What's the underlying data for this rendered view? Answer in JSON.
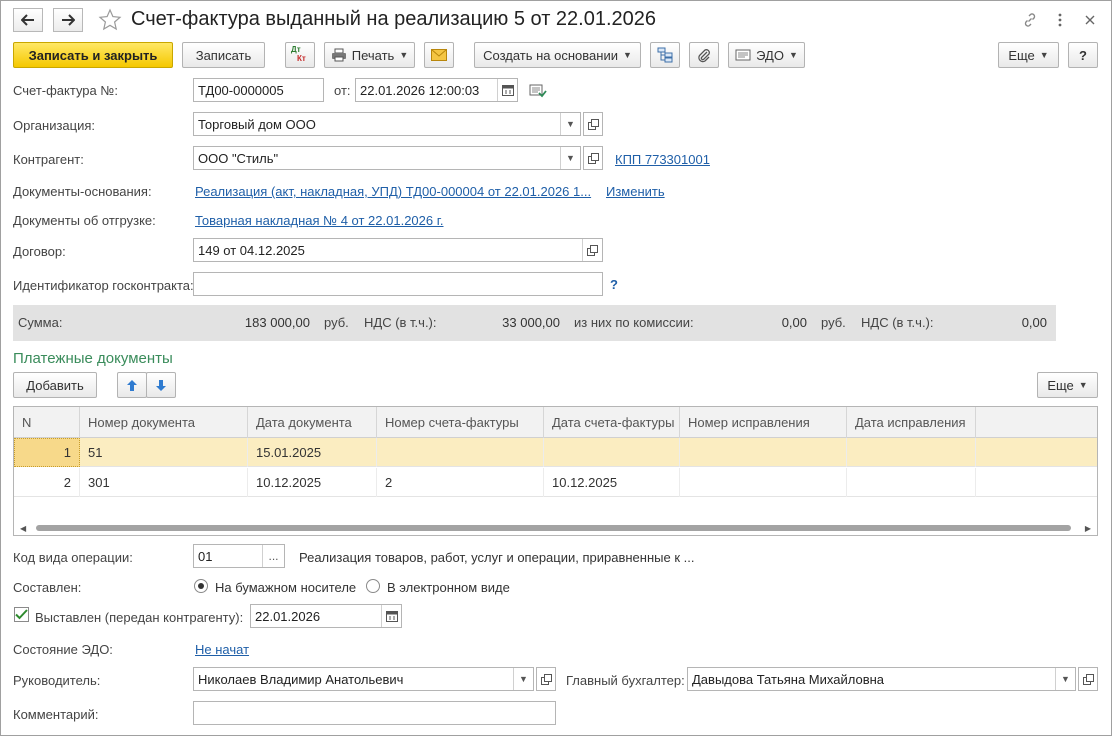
{
  "window": {
    "title": "Счет-фактура выданный на реализацию 5 от 22.01.2026"
  },
  "toolbar": {
    "write_close": "Записать и закрыть",
    "write": "Записать",
    "dtkt_dt": "Дт",
    "dtkt_kt": "Кт",
    "print": "Печать",
    "create_based": "Создать на основании",
    "edo": "ЭДО",
    "more": "Еще",
    "help": "?"
  },
  "header": {
    "invoice_no_label": "Счет-фактура №:",
    "invoice_no": "ТД00-0000005",
    "date_from_label": "от:",
    "date": "22.01.2026 12:00:03",
    "organization_label": "Организация:",
    "organization": "Торговый дом ООО",
    "counterparty_label": "Контрагент:",
    "counterparty": "ООО \"Стиль\"",
    "kpp_link": "КПП 773301001",
    "base_docs_label": "Документы-основания:",
    "base_docs_link": "Реализация (акт, накладная, УПД) ТД00-000004 от 22.01.2026 1...",
    "change_link": "Изменить",
    "shipment_docs_label": "Документы об отгрузке:",
    "shipment_docs_link": "Товарная накладная № 4 от 22.01.2026 г.",
    "contract_label": "Договор:",
    "contract": "149 от 04.12.2025",
    "gov_contract_label": "Идентификатор госконтракта:",
    "gov_contract": "",
    "gov_contract_help": "?"
  },
  "sums": {
    "sum_label": "Сумма:",
    "sum": "183 000,00",
    "currency1": "руб.",
    "vat_label": "НДС (в т.ч.):",
    "vat": "33 000,00",
    "commission_label": "из них по комиссии:",
    "commission": "0,00",
    "currency2": "руб.",
    "vat2_label": "НДС (в т.ч.):",
    "vat2": "0,00"
  },
  "payments": {
    "section_title": "Платежные документы",
    "add_button": "Добавить",
    "more_button": "Еще",
    "columns": [
      "N",
      "Номер документа",
      "Дата документа",
      "Номер счета-фактуры",
      "Дата счета-фактуры",
      "Номер исправления",
      "Дата исправления"
    ],
    "rows": [
      {
        "n": "1",
        "doc_no": "51",
        "doc_date": "15.01.2025",
        "inv_no": "",
        "inv_date": "",
        "fix_no": "",
        "fix_date": ""
      },
      {
        "n": "2",
        "doc_no": "301",
        "doc_date": "10.12.2025",
        "inv_no": "2",
        "inv_date": "10.12.2025",
        "fix_no": "",
        "fix_date": ""
      }
    ]
  },
  "footer": {
    "op_code_label": "Код вида операции:",
    "op_code": "01",
    "op_code_btn": "...",
    "op_code_desc": "Реализация товаров, работ, услуг и операции, приравненные к ...",
    "composed_label": "Составлен:",
    "paper_option": "На бумажном носителе",
    "electronic_option": "В электронном виде",
    "issued_label": "Выставлен (передан контрагенту):",
    "issued_date": "22.01.2026",
    "edo_state_label": "Состояние ЭДО:",
    "edo_state_link": "Не начат",
    "head_label": "Руководитель:",
    "head": "Николаев Владимир Анатольевич",
    "accountant_label": "Главный бухгалтер:",
    "accountant": "Давыдова Татьяна Михайловна",
    "comment_label": "Комментарий:",
    "comment": ""
  },
  "colors": {
    "primary_button": "#f5c800",
    "link": "#1f5fa8",
    "section_title": "#3a8c5b",
    "selected_row": "#fbedc1"
  }
}
